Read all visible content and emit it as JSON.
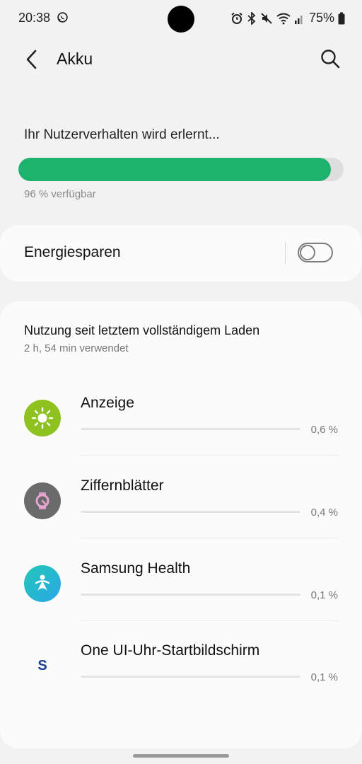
{
  "status_bar": {
    "time": "20:38",
    "battery_percent": "75%"
  },
  "header": {
    "title": "Akku"
  },
  "battery": {
    "learning_text": "Ihr Nutzerverhalten wird erlernt...",
    "level_fraction": 0.96,
    "available_text": "96 % verfügbar",
    "bar_color": "#1db36f"
  },
  "power_saving": {
    "label": "Energiesparen",
    "enabled": false
  },
  "usage": {
    "title": "Nutzung seit letztem vollständigem Laden",
    "subtitle": "2 h, 54 min verwendet",
    "apps": [
      {
        "name": "Anzeige",
        "percent": "0,6 %",
        "icon": "sun-icon",
        "icon_color": "#8dc21f"
      },
      {
        "name": "Ziffernblätter",
        "percent": "0,4 %",
        "icon": "watchface-icon",
        "icon_color": "#6b6b6b"
      },
      {
        "name": "Samsung Health",
        "percent": "0,1 %",
        "icon": "samsung-health-icon",
        "icon_color": "#1fb5d6"
      },
      {
        "name": "One UI-Uhr-Startbildschirm",
        "percent": "0,1 %",
        "icon": "samsung-s-icon",
        "icon_color": "#1a3f8f"
      }
    ]
  }
}
